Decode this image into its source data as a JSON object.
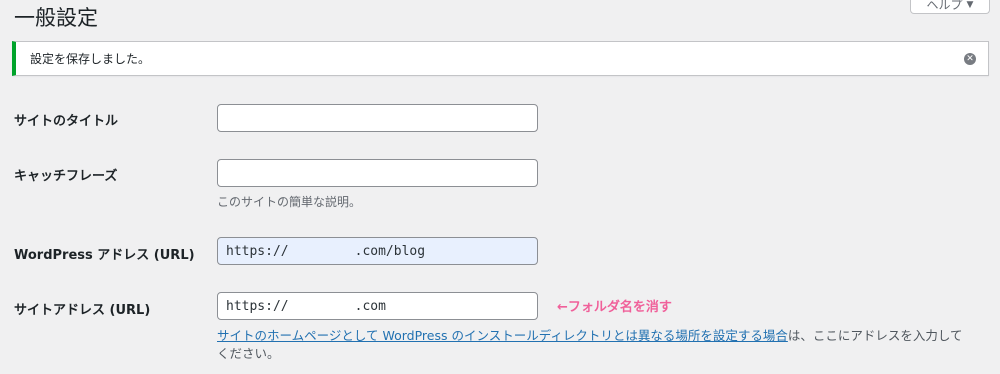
{
  "page": {
    "title": "一般設定",
    "help_label": "ヘルプ",
    "help_arrow": "▼"
  },
  "notice": {
    "message": "設定を保存しました。",
    "dismiss_icon": "close-circle-icon"
  },
  "fields": {
    "site_title": {
      "label": "サイトのタイトル",
      "value": ""
    },
    "tagline": {
      "label": "キャッチフレーズ",
      "value": "",
      "description": "このサイトの簡単な説明。"
    },
    "wp_address": {
      "label": "WordPress アドレス (URL)",
      "prefix": "https://",
      "suffix": ".com/blog"
    },
    "site_address": {
      "label": "サイトアドレス (URL)",
      "prefix": "https://",
      "suffix": ".com",
      "annotation": "←フォルダ名を消す",
      "help_link": "サイトのホームページとして WordPress のインストールディレクトリとは異なる場所を設定する場合",
      "help_rest": "は、ここにアドレスを入力して",
      "help_rest_2": "ください。"
    }
  },
  "colors": {
    "accent": "#2271b1",
    "success": "#00a32a",
    "annotation": "#f0609a"
  }
}
